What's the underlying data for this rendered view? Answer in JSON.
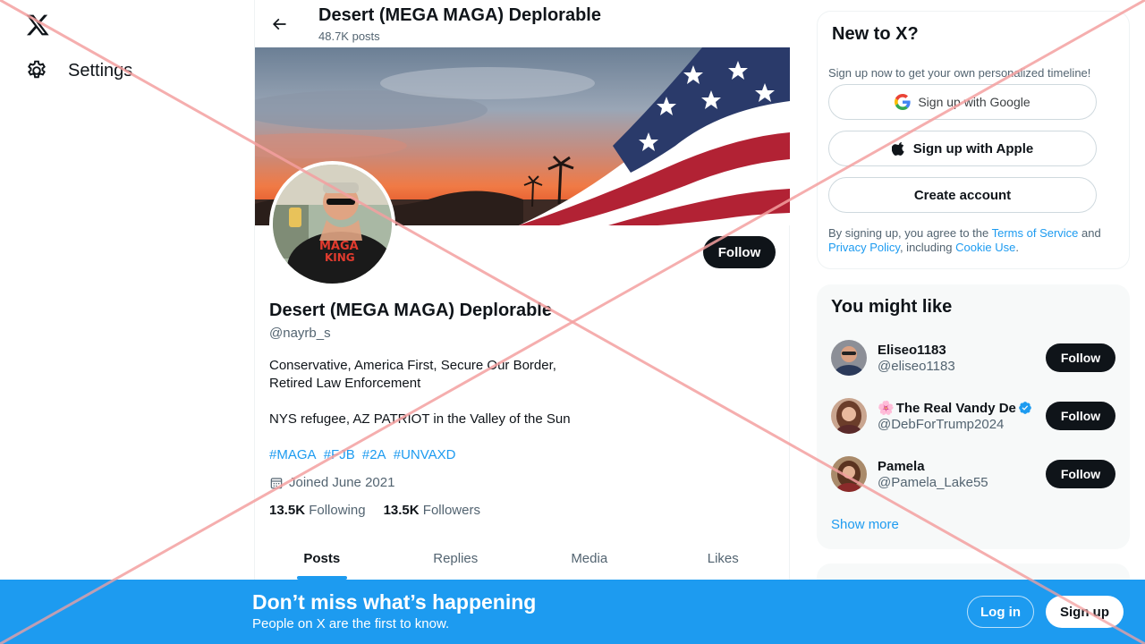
{
  "nav": {
    "settings_label": "Settings"
  },
  "header": {
    "title": "Desert (MEGA MAGA) Deplorable",
    "posts_count": "48.7K posts"
  },
  "profile": {
    "follow_label": "Follow",
    "name": "Desert (MEGA MAGA) Deplorable",
    "handle": "@nayrb_s",
    "bio_lines": [
      "Conservative, America First, Secure Our Border,",
      "Retired Law Enforcement",
      "NYS refugee, AZ PATRIOT  in the Valley of the Sun"
    ],
    "hashtags": [
      "#MAGA",
      "#FJB",
      "#2A",
      "#UNVAXD"
    ],
    "joined": "Joined June 2021",
    "following_count": "13.5K",
    "following_label": "Following",
    "followers_count": "13.5K",
    "followers_label": "Followers"
  },
  "tabs": [
    "Posts",
    "Replies",
    "Media",
    "Likes"
  ],
  "signup_card": {
    "title": "New to X?",
    "subtitle": "Sign up now to get your own personalized timeline!",
    "google_label": "Sign up with Google",
    "apple_label": "Sign up with Apple",
    "create_label": "Create account",
    "legal_pre": "By signing up, you agree to the ",
    "terms": "Terms of Service",
    "legal_and": " and ",
    "privacy": "Privacy Policy",
    "legal_including": ", including ",
    "cookie": "Cookie Use",
    "legal_end": "."
  },
  "suggestions": {
    "title": "You might like",
    "users": [
      {
        "name": "Eliseo1183",
        "handle": "@eliseo1183",
        "follow": "Follow",
        "emoji": "",
        "verified": false
      },
      {
        "name": "The Real Vandy De",
        "handle": "@DebForTrump2024",
        "follow": "Follow",
        "emoji": "🌸",
        "verified": true
      },
      {
        "name": "Pamela",
        "handle": "@Pamela_Lake55",
        "follow": "Follow",
        "emoji": "",
        "verified": false
      }
    ],
    "show_more": "Show more"
  },
  "bottom_bar": {
    "title": "Don’t miss what’s happening",
    "subtitle": "People on X are the first to know.",
    "login": "Log in",
    "signup": "Sign up"
  },
  "colors": {
    "accent": "#1d9bf0",
    "text": "#0f1419",
    "muted": "#536471",
    "overlay_x": "#f4a0a0"
  }
}
